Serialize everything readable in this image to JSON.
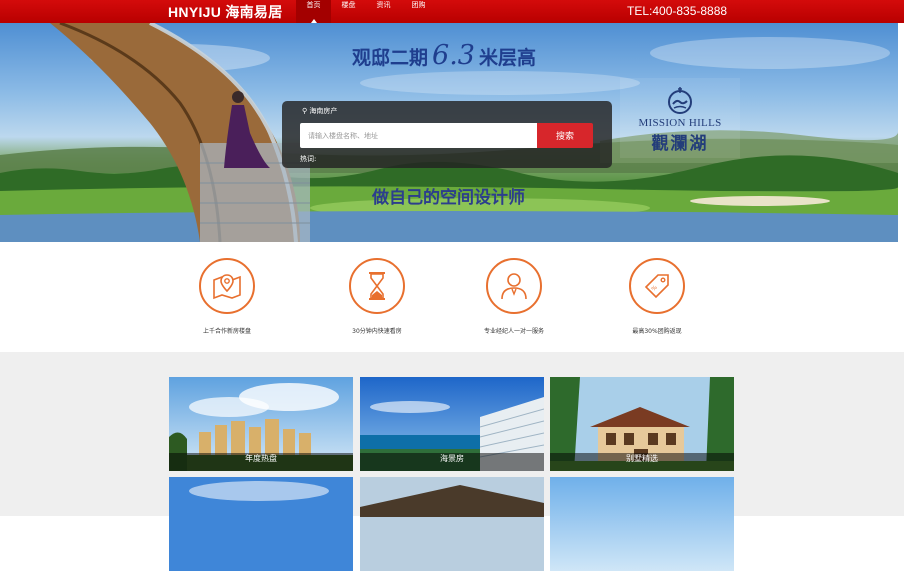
{
  "header": {
    "logo": "HNYIJU 海南易居",
    "nav": [
      {
        "label": "首页",
        "active": true
      },
      {
        "label": "楼盘",
        "active": false
      },
      {
        "label": "资讯",
        "active": false
      },
      {
        "label": "团购",
        "active": false
      }
    ],
    "phone": "TEL:400-835-8888",
    "accent_color": "#c40000"
  },
  "banner": {
    "headline_a": "观邸二期",
    "headline_num": "6.3",
    "headline_b": "米层高",
    "slogan": "做自己的空间设计师",
    "brand_en": "MISSION HILLS",
    "brand_cn": "觀瀾湖"
  },
  "search": {
    "city": "海南房产",
    "placeholder": "请输入楼盘名称、地址",
    "value": "",
    "button": "搜索",
    "hot_label": "热词:"
  },
  "features": [
    {
      "label": "上千合作新房楼盘",
      "icon": "map-pin-icon"
    },
    {
      "label": "30分钟内快速看房",
      "icon": "hourglass-icon"
    },
    {
      "label": "专业经纪人一对一服务",
      "icon": "agent-icon"
    },
    {
      "label": "最高30%团购返现",
      "icon": "discount-tag-icon"
    }
  ],
  "gallery": [
    {
      "caption": "年度热盘"
    },
    {
      "caption": "海景房"
    },
    {
      "caption": "别墅精选"
    },
    {
      "caption": ""
    },
    {
      "caption": ""
    },
    {
      "caption": ""
    }
  ],
  "colors": {
    "feature_ring": "#e8702f",
    "search_button": "#d7262b"
  }
}
